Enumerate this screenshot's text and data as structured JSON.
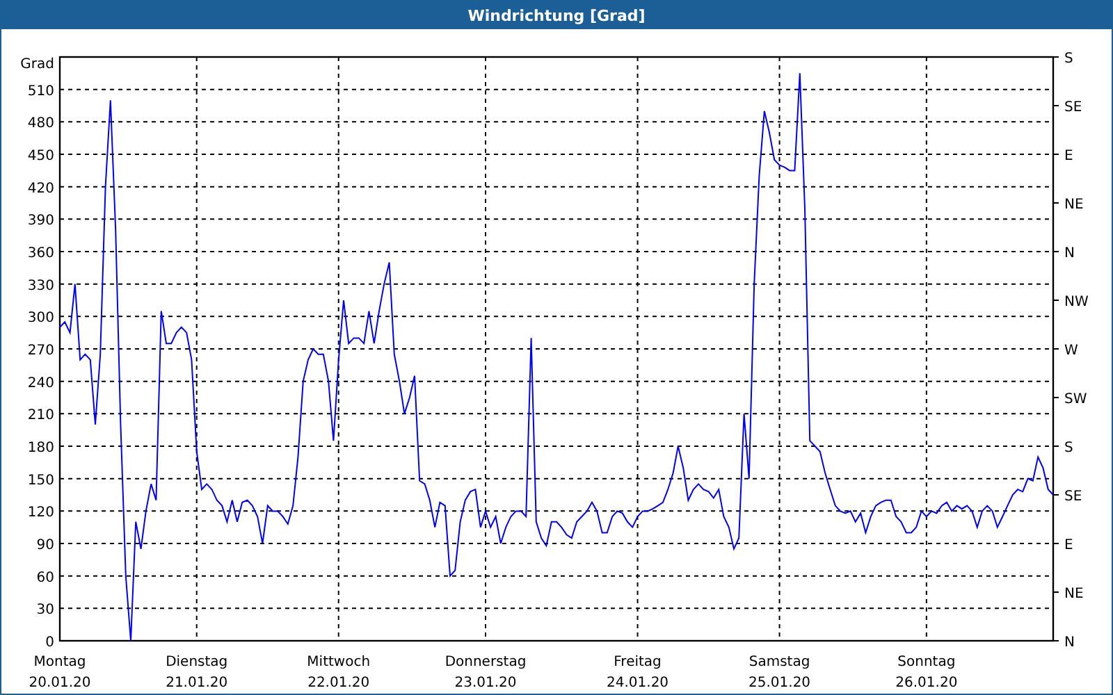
{
  "window": {
    "title": "Windrichtung [Grad]"
  },
  "chart": {
    "chart_data": {
      "type": "line",
      "grid": true,
      "ylabel": "Grad",
      "ylim": [
        0,
        540
      ],
      "yticks": [
        0,
        30,
        60,
        90,
        120,
        150,
        180,
        210,
        240,
        270,
        300,
        330,
        360,
        390,
        420,
        450,
        480,
        510
      ],
      "categories": [
        "Montag\n20.01.20",
        null,
        null,
        null,
        null,
        null,
        null,
        null,
        null,
        null,
        null,
        null,
        null,
        null,
        null,
        null,
        null,
        null,
        null,
        null,
        null,
        null,
        null,
        null,
        null,
        null,
        null,
        "Dienstag\n21.01.20",
        null,
        null,
        null,
        null,
        null,
        null,
        null,
        null,
        null,
        null,
        null,
        null,
        null,
        null,
        null,
        null,
        null,
        null,
        null,
        null,
        null,
        null,
        null,
        null,
        null,
        null,
        null,
        "Mittwoch\n22.01.20",
        null,
        null,
        null,
        null,
        null,
        null,
        null,
        null,
        null,
        null,
        null,
        null,
        null,
        null,
        null,
        null,
        null,
        null,
        null,
        null,
        null,
        null,
        null,
        null,
        null,
        null,
        null,
        null,
        "Donnerstag\n23.01.20",
        null,
        null,
        null,
        null,
        null,
        null,
        null,
        null,
        null,
        null,
        null,
        null,
        null,
        null,
        null,
        null,
        null,
        null,
        null,
        null,
        null,
        null,
        null,
        null,
        null,
        null,
        null,
        null,
        null,
        "Freitag\n24.01.20",
        null,
        null,
        null,
        null,
        null,
        null,
        null,
        null,
        null,
        null,
        null,
        null,
        null,
        null,
        null,
        null,
        null,
        null,
        null,
        null,
        null,
        null,
        null,
        null,
        null,
        null,
        null,
        "Samstag\n25.01.20",
        null,
        null,
        null,
        null,
        null,
        null,
        null,
        null,
        null,
        null,
        null,
        null,
        null,
        null,
        null,
        null,
        null,
        null,
        null,
        null,
        null,
        null,
        null,
        null,
        null,
        null,
        null,
        null,
        "Sonntag\n26.01.20",
        null,
        null,
        null,
        null,
        null,
        null,
        null,
        null,
        null,
        null,
        null,
        null,
        null,
        null,
        null,
        null,
        null,
        null,
        null,
        null,
        null,
        null,
        null,
        null,
        null
      ],
      "series": [
        {
          "color": "#0000ff",
          "values": [
            290,
            295,
            285,
            330,
            260,
            265,
            260,
            200,
            265,
            420,
            500,
            380,
            200,
            60,
            0,
            110,
            85,
            120,
            145,
            130,
            305,
            275,
            275,
            285,
            290,
            285,
            260,
            175,
            140,
            145,
            140,
            130,
            125,
            110,
            130,
            110,
            128,
            130,
            125,
            115,
            90,
            125,
            120,
            120,
            115,
            108,
            125,
            170,
            240,
            260,
            270,
            265,
            265,
            240,
            185,
            260,
            315,
            275,
            280,
            280,
            275,
            305,
            275,
            305,
            330,
            350,
            265,
            240,
            210,
            225,
            245,
            148,
            145,
            130,
            105,
            128,
            125,
            60,
            65,
            110,
            130,
            138,
            140,
            105,
            120,
            105,
            115,
            90,
            105,
            115,
            120,
            120,
            115,
            280,
            110,
            95,
            88,
            110,
            110,
            105,
            98,
            95,
            110,
            115,
            120,
            128,
            120,
            100,
            100,
            115,
            120,
            118,
            110,
            105,
            115,
            120,
            120,
            122,
            125,
            128,
            140,
            155,
            180,
            160,
            130,
            140,
            145,
            140,
            138,
            132,
            140,
            115,
            105,
            85,
            95,
            210,
            150,
            330,
            430,
            490,
            470,
            445,
            440,
            438,
            435,
            435,
            525,
            400,
            185,
            180,
            175,
            155,
            140,
            125,
            120,
            118,
            120,
            110,
            118,
            100,
            115,
            125,
            128,
            130,
            130,
            115,
            110,
            100,
            100,
            105,
            120,
            115,
            120,
            118,
            125,
            128,
            120,
            125,
            122,
            125,
            120,
            105,
            120,
            125,
            120,
            105,
            115,
            125,
            135,
            140,
            138,
            150,
            148,
            170,
            160,
            140,
            135
          ]
        }
      ]
    },
    "compass_ticks": [
      "S",
      "SE",
      "E",
      "NE",
      "N",
      "NW",
      "W",
      "SW",
      "S",
      "SE",
      "E",
      "NE",
      "N"
    ]
  }
}
